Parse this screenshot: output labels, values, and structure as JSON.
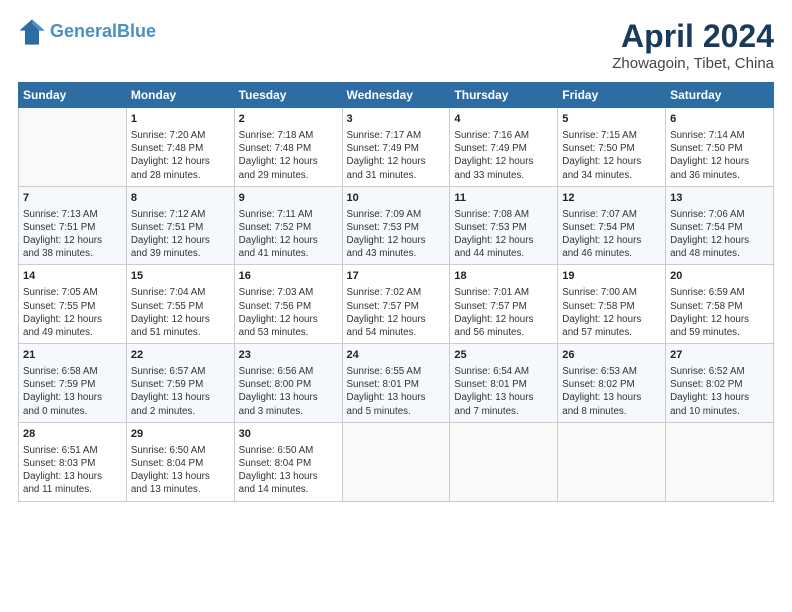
{
  "header": {
    "logo_line1": "General",
    "logo_line2": "Blue",
    "title": "April 2024",
    "subtitle": "Zhowagoin, Tibet, China"
  },
  "days_of_week": [
    "Sunday",
    "Monday",
    "Tuesday",
    "Wednesday",
    "Thursday",
    "Friday",
    "Saturday"
  ],
  "weeks": [
    [
      {
        "day": "",
        "info": ""
      },
      {
        "day": "1",
        "info": "Sunrise: 7:20 AM\nSunset: 7:48 PM\nDaylight: 12 hours\nand 28 minutes."
      },
      {
        "day": "2",
        "info": "Sunrise: 7:18 AM\nSunset: 7:48 PM\nDaylight: 12 hours\nand 29 minutes."
      },
      {
        "day": "3",
        "info": "Sunrise: 7:17 AM\nSunset: 7:49 PM\nDaylight: 12 hours\nand 31 minutes."
      },
      {
        "day": "4",
        "info": "Sunrise: 7:16 AM\nSunset: 7:49 PM\nDaylight: 12 hours\nand 33 minutes."
      },
      {
        "day": "5",
        "info": "Sunrise: 7:15 AM\nSunset: 7:50 PM\nDaylight: 12 hours\nand 34 minutes."
      },
      {
        "day": "6",
        "info": "Sunrise: 7:14 AM\nSunset: 7:50 PM\nDaylight: 12 hours\nand 36 minutes."
      }
    ],
    [
      {
        "day": "7",
        "info": "Sunrise: 7:13 AM\nSunset: 7:51 PM\nDaylight: 12 hours\nand 38 minutes."
      },
      {
        "day": "8",
        "info": "Sunrise: 7:12 AM\nSunset: 7:51 PM\nDaylight: 12 hours\nand 39 minutes."
      },
      {
        "day": "9",
        "info": "Sunrise: 7:11 AM\nSunset: 7:52 PM\nDaylight: 12 hours\nand 41 minutes."
      },
      {
        "day": "10",
        "info": "Sunrise: 7:09 AM\nSunset: 7:53 PM\nDaylight: 12 hours\nand 43 minutes."
      },
      {
        "day": "11",
        "info": "Sunrise: 7:08 AM\nSunset: 7:53 PM\nDaylight: 12 hours\nand 44 minutes."
      },
      {
        "day": "12",
        "info": "Sunrise: 7:07 AM\nSunset: 7:54 PM\nDaylight: 12 hours\nand 46 minutes."
      },
      {
        "day": "13",
        "info": "Sunrise: 7:06 AM\nSunset: 7:54 PM\nDaylight: 12 hours\nand 48 minutes."
      }
    ],
    [
      {
        "day": "14",
        "info": "Sunrise: 7:05 AM\nSunset: 7:55 PM\nDaylight: 12 hours\nand 49 minutes."
      },
      {
        "day": "15",
        "info": "Sunrise: 7:04 AM\nSunset: 7:55 PM\nDaylight: 12 hours\nand 51 minutes."
      },
      {
        "day": "16",
        "info": "Sunrise: 7:03 AM\nSunset: 7:56 PM\nDaylight: 12 hours\nand 53 minutes."
      },
      {
        "day": "17",
        "info": "Sunrise: 7:02 AM\nSunset: 7:57 PM\nDaylight: 12 hours\nand 54 minutes."
      },
      {
        "day": "18",
        "info": "Sunrise: 7:01 AM\nSunset: 7:57 PM\nDaylight: 12 hours\nand 56 minutes."
      },
      {
        "day": "19",
        "info": "Sunrise: 7:00 AM\nSunset: 7:58 PM\nDaylight: 12 hours\nand 57 minutes."
      },
      {
        "day": "20",
        "info": "Sunrise: 6:59 AM\nSunset: 7:58 PM\nDaylight: 12 hours\nand 59 minutes."
      }
    ],
    [
      {
        "day": "21",
        "info": "Sunrise: 6:58 AM\nSunset: 7:59 PM\nDaylight: 13 hours\nand 0 minutes."
      },
      {
        "day": "22",
        "info": "Sunrise: 6:57 AM\nSunset: 7:59 PM\nDaylight: 13 hours\nand 2 minutes."
      },
      {
        "day": "23",
        "info": "Sunrise: 6:56 AM\nSunset: 8:00 PM\nDaylight: 13 hours\nand 3 minutes."
      },
      {
        "day": "24",
        "info": "Sunrise: 6:55 AM\nSunset: 8:01 PM\nDaylight: 13 hours\nand 5 minutes."
      },
      {
        "day": "25",
        "info": "Sunrise: 6:54 AM\nSunset: 8:01 PM\nDaylight: 13 hours\nand 7 minutes."
      },
      {
        "day": "26",
        "info": "Sunrise: 6:53 AM\nSunset: 8:02 PM\nDaylight: 13 hours\nand 8 minutes."
      },
      {
        "day": "27",
        "info": "Sunrise: 6:52 AM\nSunset: 8:02 PM\nDaylight: 13 hours\nand 10 minutes."
      }
    ],
    [
      {
        "day": "28",
        "info": "Sunrise: 6:51 AM\nSunset: 8:03 PM\nDaylight: 13 hours\nand 11 minutes."
      },
      {
        "day": "29",
        "info": "Sunrise: 6:50 AM\nSunset: 8:04 PM\nDaylight: 13 hours\nand 13 minutes."
      },
      {
        "day": "30",
        "info": "Sunrise: 6:50 AM\nSunset: 8:04 PM\nDaylight: 13 hours\nand 14 minutes."
      },
      {
        "day": "",
        "info": ""
      },
      {
        "day": "",
        "info": ""
      },
      {
        "day": "",
        "info": ""
      },
      {
        "day": "",
        "info": ""
      }
    ]
  ]
}
